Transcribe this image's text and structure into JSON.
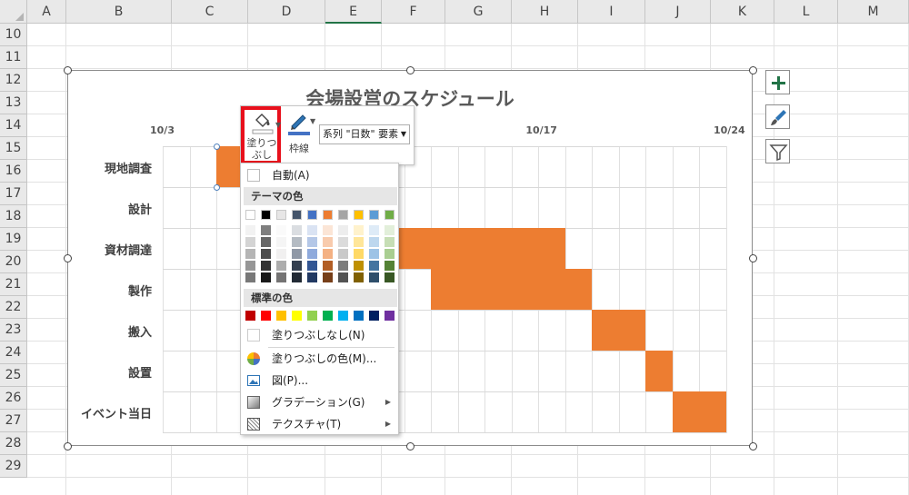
{
  "sheet": {
    "columns": [
      "A",
      "B",
      "C",
      "D",
      "E",
      "F",
      "G",
      "H",
      "I",
      "J",
      "K",
      "L",
      "M"
    ],
    "selected_column": "E",
    "rows": [
      "10",
      "11",
      "12",
      "13",
      "14",
      "15",
      "16",
      "17",
      "18",
      "19",
      "20",
      "21",
      "22",
      "23",
      "24",
      "25",
      "26",
      "27",
      "28",
      "29"
    ]
  },
  "chart": {
    "title": "会場設営のスケジュール",
    "x_ticks": [
      "10/3",
      "10/17",
      "10/24"
    ],
    "bar_color": "#ed7d31"
  },
  "chart_data": {
    "type": "bar",
    "title": "会場設営のスケジュール",
    "xlabel": "",
    "ylabel": "",
    "x_ticks": [
      "10/3",
      "10/17",
      "10/24"
    ],
    "categories": [
      "現地調査",
      "設計",
      "資材調達",
      "製作",
      "搬入",
      "設置",
      "イベント当日"
    ],
    "series": [
      {
        "values": [
          2,
          4,
          7,
          6,
          2,
          1,
          2
        ]
      }
    ],
    "start_dates": [
      "10/5",
      "10/7",
      "10/11",
      "10/13",
      "10/19",
      "10/21",
      "10/22"
    ],
    "stacked": true,
    "grid": true,
    "legend": "none"
  },
  "side_buttons": [
    "chart-elements-icon",
    "chart-styles-icon",
    "chart-filters-icon"
  ],
  "mini_toolbar": {
    "fill_label_line1": "塗りつ",
    "fill_label_line2": "ぶし",
    "outline_label": "枠線",
    "series_selector": "系列 \"日数\" 要素"
  },
  "fill_menu": {
    "automatic": "自動(A)",
    "theme_colors_header": "テーマの色",
    "standard_colors_header": "標準の色",
    "no_fill": "塗りつぶしなし(N)",
    "more_colors": "塗りつぶしの色(M)...",
    "picture": "図(P)...",
    "gradient": "グラデーション(G)",
    "texture": "テクスチャ(T)",
    "theme_colors": [
      "#ffffff",
      "#000000",
      "#e7e6e6",
      "#44546a",
      "#4472c4",
      "#ed7d31",
      "#a5a5a5",
      "#ffc000",
      "#5b9bd5",
      "#70ad47"
    ],
    "standard_colors": [
      "#c00000",
      "#ff0000",
      "#ffc000",
      "#ffff00",
      "#92d050",
      "#00b050",
      "#00b0f0",
      "#0070c0",
      "#002060",
      "#7030a0"
    ]
  }
}
